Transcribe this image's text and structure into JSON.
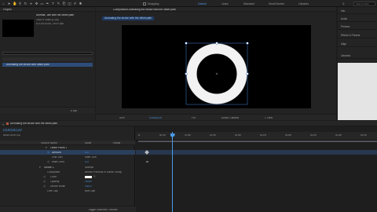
{
  "toolbar": {
    "snapping": "Snapping",
    "workspaces": [
      "Default",
      "Learn",
      "Standard",
      "Small Screen",
      "Libraries"
    ],
    "search_placeholder": "Search Help"
  },
  "project": {
    "title": "Project",
    "comp_name": "Animati...ate with the offset path",
    "comp_size": "1920 x 1080 (1.00)",
    "comp_duration": "Δ 0;00;10;00, 29.97 fps",
    "item_name": "Animating the stroke with offset path",
    "footer_bpc": "8 bpc"
  },
  "composition": {
    "tab_label": "Composition Animating the stroke with the offset path",
    "breadcrumb": "Animating the stroke with the offset path",
    "zoom": "50%",
    "timecode": "0;00;00;20",
    "resolution": "Full",
    "camera": "Active Camera",
    "views": "1 View"
  },
  "right_panel": {
    "items": [
      "Info",
      "Audio",
      "Preview",
      "Effects & Presets",
      "Align",
      "Libraries"
    ]
  },
  "timeline": {
    "tab_label": "Animating the stroke with the offset path",
    "current_time": "0;00;00;20",
    "frame_info": "00020 (29.97 fps)",
    "col_source": "Source Name",
    "col_mode": "Mode",
    "col_trkmat": "TrkMat",
    "toggle_label": "Toggle Switches / Modes",
    "ruler_labels": [
      "0f",
      "00:15f",
      "01:00f",
      "01:15f",
      "02:00f",
      "02:15f",
      "03:00f",
      "03:15f",
      "04:00f",
      "04:15f"
    ],
    "rows": [
      {
        "name": "Offset Paths 1",
        "value": ""
      },
      {
        "name": "Amount",
        "value": "0.0"
      },
      {
        "name": "Line Join",
        "value": "Miter Join"
      },
      {
        "name": "Miter Limit",
        "value": "4.0"
      },
      {
        "name": "Stroke 1",
        "value": "Normal"
      },
      {
        "name": "Composite",
        "value": "Below Previous in Same Group"
      },
      {
        "name": "Color",
        "value": ""
      },
      {
        "name": "Opacity",
        "value": "100%"
      },
      {
        "name": "Stroke Width",
        "value": "100.0"
      },
      {
        "name": "Line Cap",
        "value": "Butt Cap"
      }
    ]
  }
}
